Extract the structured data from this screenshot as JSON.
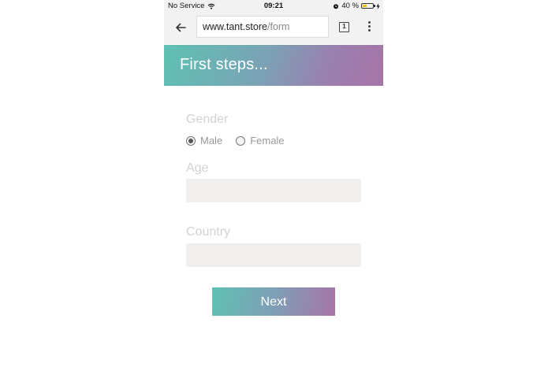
{
  "status_bar": {
    "carrier": "No Service",
    "time": "09:21",
    "battery_percent": "40 %",
    "battery_level": 0.4,
    "icons": [
      "wifi-icon",
      "alarm-icon",
      "battery-icon",
      "charging-icon"
    ]
  },
  "browser": {
    "url_host": "www.tant.store",
    "url_path": "/form",
    "tab_count": "1",
    "icons": [
      "back-arrow-icon",
      "tabs-icon",
      "menu-dots-icon"
    ]
  },
  "header": {
    "title": "First steps...",
    "gradient_start": "#5ec1b3",
    "gradient_end": "#a774a7"
  },
  "form": {
    "gender_label": "Gender",
    "gender_options": [
      {
        "label": "Male",
        "selected": true
      },
      {
        "label": "Female",
        "selected": false
      }
    ],
    "age_label": "Age",
    "age_value": "",
    "country_label": "Country",
    "country_value": "",
    "next_label": "Next"
  }
}
